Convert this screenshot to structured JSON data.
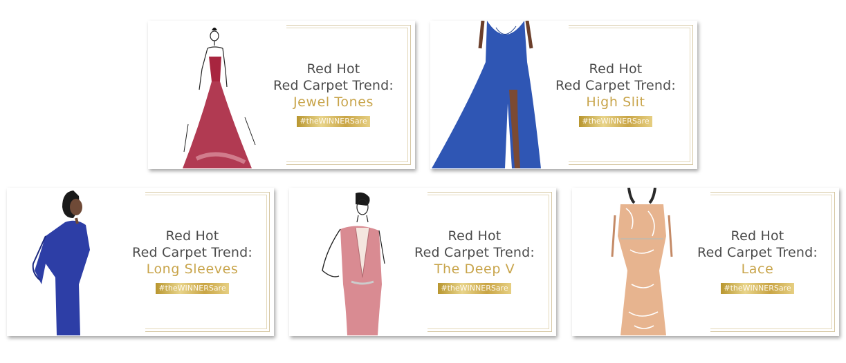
{
  "brand": {
    "gold": "#c8a44a",
    "hashtag_gradient": [
      "#b8962f",
      "#e8d48a",
      "#c9a545"
    ]
  },
  "cards": [
    {
      "line1": "Red Hot",
      "line2": "Red Carpet Trend:",
      "trend": "Jewel Tones",
      "hashtag": "#theWINNERSare",
      "dress_color": "#a8253f",
      "figure": "illustration of a woman in a ruby red gown"
    },
    {
      "line1": "Red Hot",
      "line2": "Red Carpet Trend:",
      "trend": "High Slit",
      "hashtag": "#theWINNERSare",
      "dress_color": "#2f56b4",
      "figure": "illustration of a blue gown with a high slit"
    },
    {
      "line1": "Red Hot",
      "line2": "Red Carpet Trend:",
      "trend": "Long Sleeves",
      "hashtag": "#theWINNERSare",
      "dress_color": "#2d3ea6",
      "figure": "illustration of a woman in a long-sleeved blue dress"
    },
    {
      "line1": "Red Hot",
      "line2": "Red Carpet Trend:",
      "trend": "The Deep V",
      "hashtag": "#theWINNERSare",
      "dress_color": "#d98b92",
      "figure": "illustration of a woman in a pink deep-V gown"
    },
    {
      "line1": "Red Hot",
      "line2": "Red Carpet Trend:",
      "trend": "Lace",
      "hashtag": "#theWINNERSare",
      "dress_color": "#e7b48f",
      "figure": "illustration of a nude lace gown"
    }
  ]
}
